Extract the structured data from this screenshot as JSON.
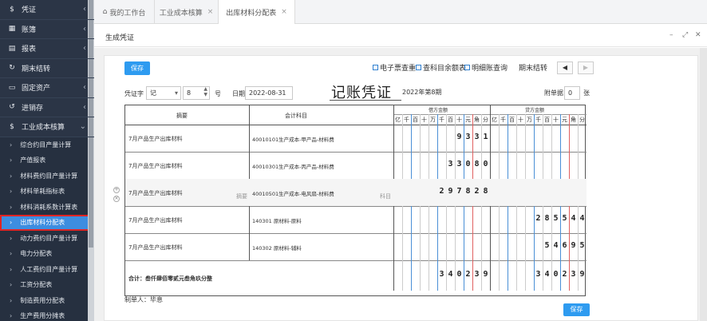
{
  "sidebar": {
    "items": [
      {
        "icon": "$",
        "label": "凭证"
      },
      {
        "icon": "▦",
        "label": "账簿"
      },
      {
        "icon": "▤",
        "label": "报表"
      },
      {
        "icon": "↻",
        "label": "期末结转"
      },
      {
        "icon": "▭",
        "label": "固定资产"
      },
      {
        "icon": "↺",
        "label": "进销存"
      },
      {
        "icon": "$",
        "label": "工业成本核算"
      }
    ],
    "subitems": [
      "综合约目产量计算",
      "产值报表",
      "材料费约目产量计算",
      "材料单耗指标表",
      "材料消耗系数计算表",
      "出库材料分配表",
      "动力费约目产量计算",
      "电力分配表",
      "人工费约目产量计算",
      "工资分配表",
      "制造费用分配表",
      "生产费用分摊表"
    ]
  },
  "tabs": [
    {
      "label": "我的工作台"
    },
    {
      "label": "工业成本核算"
    },
    {
      "label": "出库材料分配表"
    }
  ],
  "dialog": {
    "title": "生成凭证"
  },
  "toolbar": {
    "save": "保存",
    "einvoice": "电子票查重",
    "balance": "查科目余额表",
    "detail": "明细账查询",
    "period_end": "期末结转",
    "prev": "◀",
    "next": "▶"
  },
  "voucher": {
    "word_label": "凭证字",
    "word_value": "记",
    "number_value": "8",
    "number_suffix": "号",
    "date_label": "日期",
    "date_value": "2022-08-31",
    "title": "记账凭证",
    "period": "2022年第8期",
    "attach_label": "附单据",
    "attach_value": "0",
    "attach_suffix": "张",
    "col_summary": "摘要",
    "col_account": "会计科目",
    "col_debit": "借方金额",
    "col_credit": "贷方金额",
    "digit_headers": [
      "亿",
      "千",
      "百",
      "十",
      "万",
      "千",
      "百",
      "十",
      "元",
      "角",
      "分"
    ],
    "summary_hint": "摘要",
    "account_hint": "科目",
    "rows": [
      {
        "summary": "7月产品生产出库材料",
        "account": "40010101生产成本-甲产品-材料费",
        "debit": "9331",
        "credit": ""
      },
      {
        "summary": "7月产品生产出库材料",
        "account": "40010301生产成本-丙产品-材料费",
        "debit": "33080",
        "credit": ""
      },
      {
        "summary": "7月产品生产出库材料",
        "account": "40010501生产成本-电风扇-材料费",
        "debit": "297828",
        "credit": ""
      },
      {
        "summary": "7月产品生产出库材料",
        "account": "140301 原材料-原料",
        "debit": "",
        "credit": "285544"
      },
      {
        "summary": "7月产品生产出库材料",
        "account": "140302 原材料-辅料",
        "debit": "",
        "credit": "54695"
      }
    ],
    "total_label": "合计：叁仟肆佰零贰元叁角玖分整",
    "total_debit": "340239",
    "total_credit": "340239",
    "maker": "制单人：毕息",
    "save_bottom": "保存"
  }
}
